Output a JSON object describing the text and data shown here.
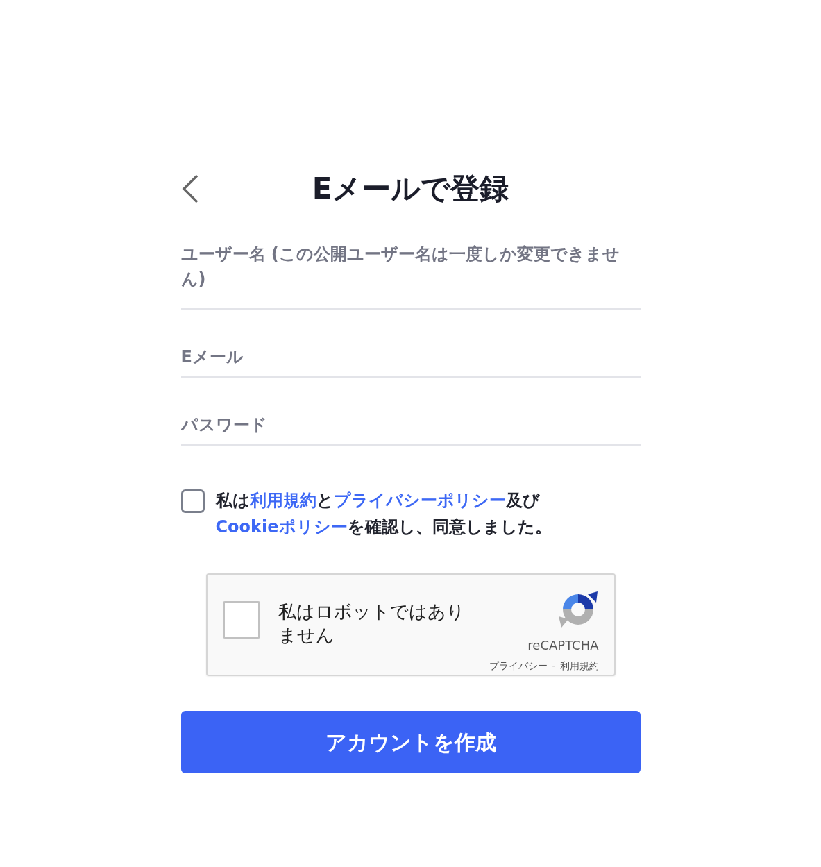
{
  "header": {
    "title": "Eメールで登録"
  },
  "fields": [
    {
      "kind": "textarea",
      "placeholder": "ユーザー名 (この公開ユーザー名は一度しか変更できません)"
    },
    {
      "kind": "email",
      "placeholder": "Eメール"
    },
    {
      "kind": "password",
      "placeholder": "パスワード"
    }
  ],
  "agreement": {
    "checked": false,
    "parts": [
      {
        "kind": "text",
        "text": "私は"
      },
      {
        "kind": "link",
        "text": "利用規約"
      },
      {
        "kind": "text",
        "text": "と"
      },
      {
        "kind": "link",
        "text": "プライバシーポリシー"
      },
      {
        "kind": "text",
        "text": "及び"
      },
      {
        "kind": "link",
        "text": "Cookieポリシー"
      },
      {
        "kind": "text",
        "text": "を確認し、同意しました。"
      }
    ]
  },
  "captcha": {
    "checked": false,
    "label": "私はロボットではありません",
    "brand": "reCAPTCHA",
    "links": [
      "プライバシー",
      "利用規約"
    ],
    "separator": "-"
  },
  "submit": {
    "label": "アカウントを作成"
  }
}
